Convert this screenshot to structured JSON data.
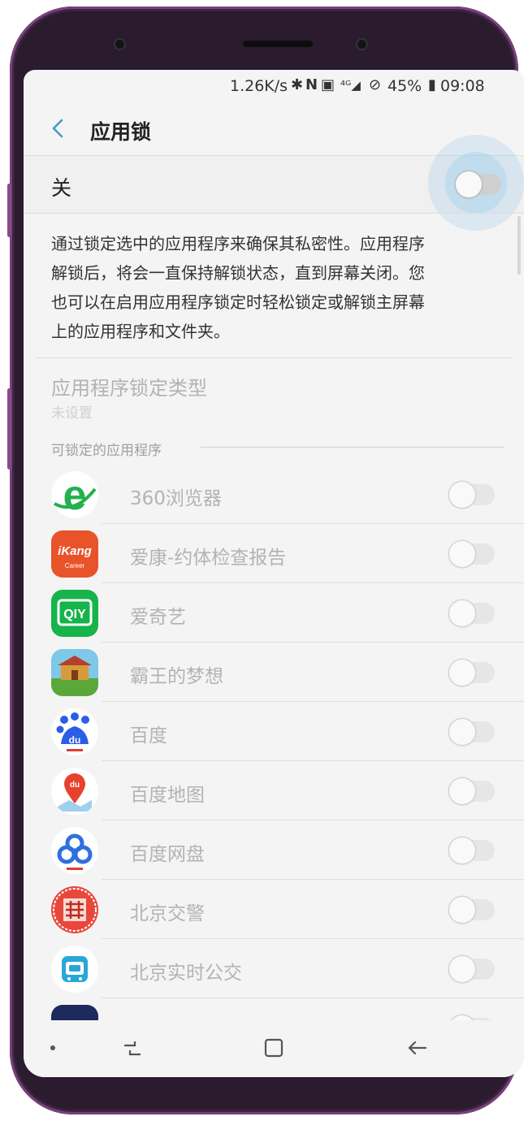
{
  "status_bar": {
    "speed": "1.26K/s",
    "battery": "45%",
    "time": "09:08"
  },
  "app_bar": {
    "title": "应用锁"
  },
  "master_switch": {
    "label": "关",
    "state": "off"
  },
  "description": "通过锁定选中的应用程序来确保其私密性。应用程序\n解锁后，将会一直保持解锁状态，直到屏幕关闭。您\n也可以在启用应用程序锁定时轻松锁定或解锁主屏幕\n上的应用程序和文件夹。",
  "lock_type": {
    "title": "应用程序锁定类型",
    "value": "未设置"
  },
  "lockable_section": {
    "header": "可锁定的应用程序"
  },
  "apps": [
    {
      "name": "360浏览器",
      "icon": "360-browser-icon",
      "locked": false
    },
    {
      "name": "爱康-约体检查报告",
      "icon": "ikang-icon",
      "locked": false
    },
    {
      "name": "爱奇艺",
      "icon": "iqiyi-icon",
      "locked": false
    },
    {
      "name": "霸王的梦想",
      "icon": "game-icon",
      "locked": false
    },
    {
      "name": "百度",
      "icon": "baidu-icon",
      "locked": false
    },
    {
      "name": "百度地图",
      "icon": "baidu-map-icon",
      "locked": false
    },
    {
      "name": "百度网盘",
      "icon": "baidu-netdisk-icon",
      "locked": false
    },
    {
      "name": "北京交警",
      "icon": "beijing-traffic-police-icon",
      "locked": false
    },
    {
      "name": "北京实时公交",
      "icon": "beijing-bus-icon",
      "locked": false
    }
  ],
  "colors": {
    "accent": "#3a9fc9",
    "frame": "#7b3f7c"
  }
}
